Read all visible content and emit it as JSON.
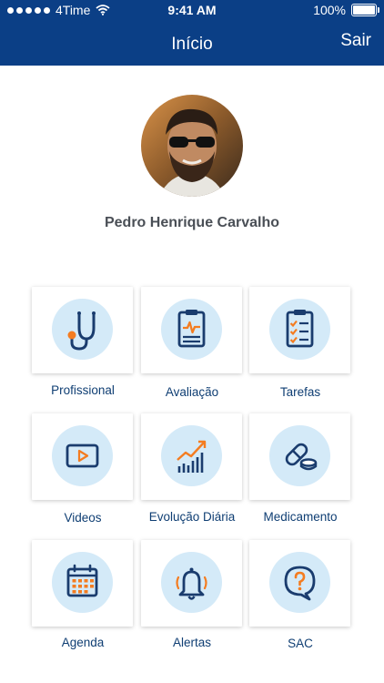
{
  "status_bar": {
    "carrier": "4Time",
    "time": "9:41 AM",
    "battery": "100%"
  },
  "nav": {
    "title": "Início",
    "logout": "Sair"
  },
  "profile": {
    "name": "Pedro Henrique Carvalho"
  },
  "menu": [
    {
      "label": "Profissional",
      "icon": "stethoscope-icon"
    },
    {
      "label": "Avaliação",
      "icon": "clipboard-chart-icon"
    },
    {
      "label": "Tarefas",
      "icon": "checklist-icon"
    },
    {
      "label": "Videos",
      "icon": "video-play-icon"
    },
    {
      "label": "Evolução Diária",
      "icon": "growth-chart-icon"
    },
    {
      "label": "Medicamento",
      "icon": "pills-icon"
    },
    {
      "label": "Agenda",
      "icon": "calendar-icon"
    },
    {
      "label": "Alertas",
      "icon": "bell-icon"
    },
    {
      "label": "SAC",
      "icon": "help-chat-icon"
    }
  ],
  "colors": {
    "header": "#0b3f86",
    "icon_navy": "#1a3c6e",
    "icon_orange": "#f47c20",
    "icon_bg": "#d4eaf8",
    "label": "#0f3e73"
  }
}
